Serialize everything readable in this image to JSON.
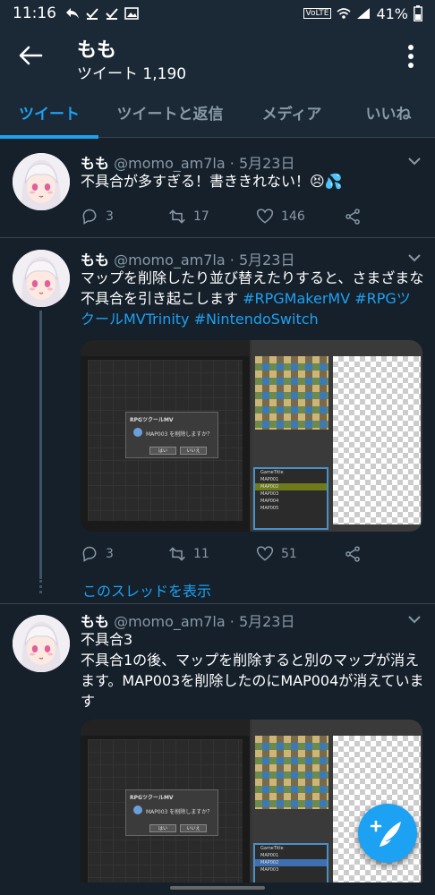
{
  "status_bar": {
    "time": "11:16",
    "battery": "41%",
    "icons": [
      "reply-arrow-icon",
      "check-icon",
      "check-icon",
      "image-icon",
      "volte-icon",
      "wifi-icon",
      "signal-icon",
      "battery-icon"
    ],
    "volte": "VoLTE"
  },
  "header": {
    "title": "もも",
    "subtitle": "ツイート 1,190"
  },
  "tabs": [
    {
      "label": "ツイート",
      "active": true
    },
    {
      "label": "ツイートと返信",
      "active": false
    },
    {
      "label": "メディア",
      "active": false
    },
    {
      "label": "いいね",
      "active": false
    }
  ],
  "tweets": [
    {
      "name": "もも",
      "handle": "@momo_am7la",
      "date": "5月23日",
      "meta": "@momo_am7la · 5月23日",
      "text": "不具合が多すぎる！書ききれない！😣💦",
      "replies": "3",
      "retweets": "17",
      "likes": "146"
    },
    {
      "name": "もも",
      "handle": "@momo_am7la",
      "date": "5月23日",
      "meta": "@momo_am7la · 5月23日",
      "text_plain": "マップを削除したり並び替えたりすると、さまざまな不具合を引き起こします ",
      "hashtags": "#RPGMakerMV #RPGツクールMVTrinity #NintendoSwitch",
      "replies": "3",
      "retweets": "11",
      "likes": "51",
      "media": {
        "dialog_title": "RPGツクールMV",
        "dialog_message": "MAP003 を削除しますか？",
        "ok": "はい",
        "cancel": "いいえ",
        "maps": [
          "GameTitle",
          "MAP001",
          "MAP002",
          "MAP003",
          "MAP004",
          "MAP005"
        ]
      }
    },
    {
      "name": "もも",
      "handle": "@momo_am7la",
      "date": "5月23日",
      "meta": "@momo_am7la · 5月23日",
      "text": "不具合3\n不具合1の後、マップを削除すると別のマップが消えます。MAP003を削除したのにMAP004が消えています",
      "media": {
        "dialog_title": "RPGツクールMV",
        "dialog_message": "MAP003 を削除しますか？",
        "ok": "はい",
        "cancel": "いいえ",
        "maps": [
          "GameTitle",
          "MAP001",
          "MAP002",
          "MAP003"
        ]
      }
    }
  ],
  "show_thread": "このスレッドを表示",
  "colors": {
    "background": "#15202b",
    "accent": "#1da1f2",
    "muted": "#8899a6"
  }
}
